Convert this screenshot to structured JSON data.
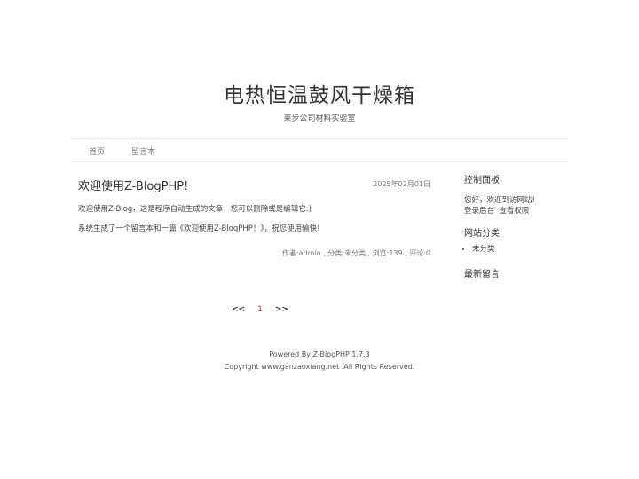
{
  "header": {
    "title": "电热恒温鼓风干燥箱",
    "subtitle": "莱步公司材料实验室"
  },
  "nav": {
    "items": [
      {
        "label": "首页"
      },
      {
        "label": "留言本"
      }
    ]
  },
  "post": {
    "title": "欢迎使用Z-BlogPHP!",
    "date": "2025年02月01日",
    "paragraphs": [
      "欢迎使用Z-Blog，这是程序自动生成的文章，您可以删除或是编辑它:)",
      "系统生成了一个留言本和一篇《欢迎使用Z-BlogPHP！》，祝您使用愉快!"
    ],
    "meta": "作者:admin , 分类:未分类 , 浏览:139 , 评论:0"
  },
  "sidebar": {
    "control_panel": {
      "heading": "控制面板",
      "greeting": "您好，欢迎到访网站!",
      "login": "登录后台",
      "permissions": "查看权限"
    },
    "categories": {
      "heading": "网站分类",
      "items": [
        "未分类"
      ]
    },
    "comments": {
      "heading": "最新留言"
    }
  },
  "pager": {
    "prev": "<<",
    "current": "1",
    "next": ">>"
  },
  "footer": {
    "powered": "Powered By Z-BlogPHP 1.7.3",
    "copyright": "Copyright www.ganzaoxiang.net .All Rights Reserved."
  }
}
